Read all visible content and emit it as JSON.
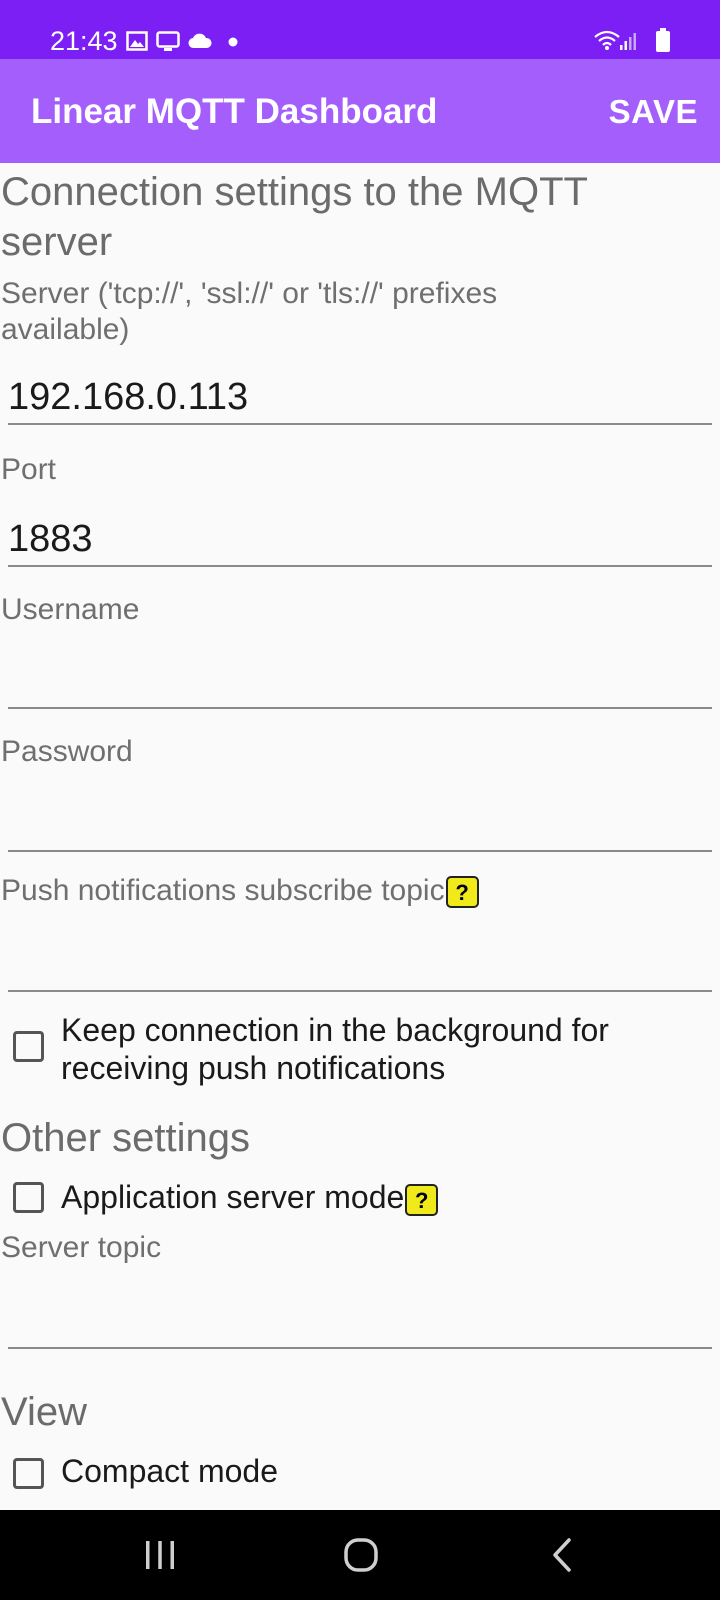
{
  "status_bar": {
    "time": "21:43",
    "left_icons": [
      "gallery-icon",
      "screen-cast-icon",
      "cloud-icon",
      "dot-icon"
    ],
    "right_icons": [
      "wifi-icon",
      "signal-icon",
      "battery-icon"
    ]
  },
  "app_bar": {
    "title": "Linear MQTT Dashboard",
    "save_label": "SAVE"
  },
  "connection": {
    "heading": "Connection settings to the MQTT server",
    "server_label": "Server ('tcp://', 'ssl://' or 'tls://' prefixes available)",
    "server_value": "192.168.0.113",
    "port_label": "Port",
    "port_value": "1883",
    "username_label": "Username",
    "username_value": "",
    "password_label": "Password",
    "password_value": "",
    "push_topic_label": "Push notifications subscribe topic",
    "push_topic_value": "",
    "keep_connection_label": "Keep connection in the background for receiving push notifications",
    "keep_connection_checked": false
  },
  "other": {
    "heading": "Other settings",
    "app_server_mode_label": "Application server mode",
    "app_server_mode_checked": false,
    "server_topic_label": "Server topic",
    "server_topic_value": ""
  },
  "view": {
    "heading": "View",
    "compact_mode_label": "Compact mode",
    "compact_mode_checked": false
  },
  "help_symbol": "?",
  "colors": {
    "status_bar": "#7c1ff5",
    "app_bar": "#a45efb",
    "help_badge": "#f0ea1b",
    "background": "#fafafa",
    "nav_bar": "#000000"
  },
  "nav_bar": {
    "icons": [
      "recent-apps-icon",
      "home-icon",
      "back-icon"
    ]
  }
}
